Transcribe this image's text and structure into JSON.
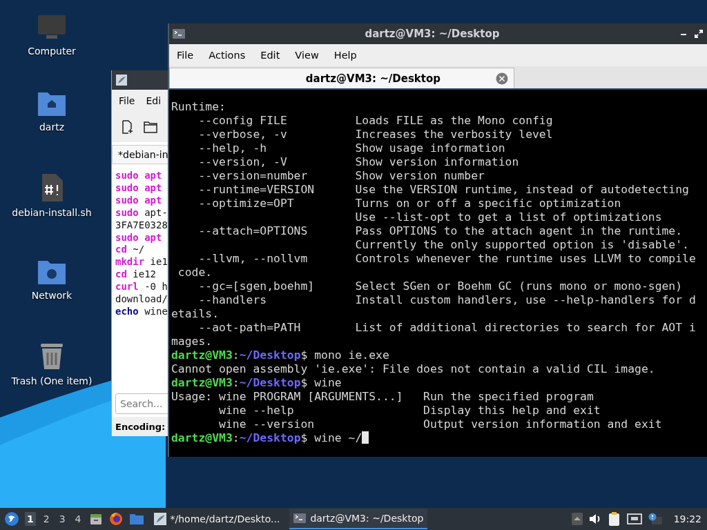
{
  "desktop_icons": [
    {
      "kind": "computer",
      "label": "Computer"
    },
    {
      "kind": "home",
      "label": "dartz"
    },
    {
      "kind": "script",
      "label": "debian-install.sh"
    },
    {
      "kind": "network",
      "label": "Network"
    },
    {
      "kind": "trash",
      "label": "Trash (One item)"
    }
  ],
  "editor": {
    "menu": [
      "File",
      "Edi"
    ],
    "tab": "*debian-in",
    "lines": [
      [
        {
          "kind": "keyword",
          "text": "sudo apt"
        }
      ],
      [
        {
          "kind": "keyword",
          "text": "sudo apt"
        }
      ],
      [
        {
          "kind": "keyword",
          "text": "sudo apt"
        }
      ],
      [
        {
          "kind": "keyword",
          "text": "sudo"
        },
        {
          "kind": "plain",
          "text": " apt-"
        }
      ],
      [
        {
          "kind": "plain",
          "text": "3FA7E0328"
        }
      ],
      [
        {
          "kind": "keyword",
          "text": "sudo apt"
        }
      ],
      [
        {
          "kind": "keyword",
          "text": "cd"
        },
        {
          "kind": "plain",
          "text": " ~/"
        }
      ],
      [
        {
          "kind": "keyword",
          "text": "mkdir"
        },
        {
          "kind": "plain",
          "text": " ie1"
        }
      ],
      [
        {
          "kind": "keyword",
          "text": "cd"
        },
        {
          "kind": "plain",
          "text": " ie12"
        }
      ],
      [
        {
          "kind": "keyword",
          "text": "curl"
        },
        {
          "kind": "plain",
          "text": " -0 h"
        }
      ],
      [
        {
          "kind": "plain",
          "text": "download/"
        }
      ],
      [
        {
          "kind": "builtin",
          "text": "echo"
        },
        {
          "kind": "plain",
          "text": " wine"
        }
      ]
    ],
    "search": {
      "placeholder": "Search..."
    },
    "status": "Encoding:"
  },
  "terminal": {
    "title": "dartz@VM3: ~/Desktop",
    "menu": [
      "File",
      "Actions",
      "Edit",
      "View",
      "Help"
    ],
    "tab": "dartz@VM3: ~/Desktop",
    "lines": [
      [
        {
          "kind": "plain",
          "text": "Runtime:"
        }
      ],
      [
        {
          "kind": "plain",
          "text": "    --config FILE          Loads FILE as the Mono config"
        }
      ],
      [
        {
          "kind": "plain",
          "text": "    --verbose, -v          Increases the verbosity level"
        }
      ],
      [
        {
          "kind": "plain",
          "text": "    --help, -h             Show usage information"
        }
      ],
      [
        {
          "kind": "plain",
          "text": "    --version, -V          Show version information"
        }
      ],
      [
        {
          "kind": "plain",
          "text": "    --version=number       Show version number"
        }
      ],
      [
        {
          "kind": "plain",
          "text": "    --runtime=VERSION      Use the VERSION runtime, instead of autodetecting"
        }
      ],
      [
        {
          "kind": "plain",
          "text": "    --optimize=OPT         Turns on or off a specific optimization"
        }
      ],
      [
        {
          "kind": "plain",
          "text": "                           Use --list-opt to get a list of optimizations"
        }
      ],
      [
        {
          "kind": "plain",
          "text": "    --attach=OPTIONS       Pass OPTIONS to the attach agent in the runtime."
        }
      ],
      [
        {
          "kind": "plain",
          "text": "                           Currently the only supported option is 'disable'."
        }
      ],
      [
        {
          "kind": "plain",
          "text": "    --llvm, --nollvm       Controls whenever the runtime uses LLVM to compile"
        }
      ],
      [
        {
          "kind": "plain",
          "text": " code."
        }
      ],
      [
        {
          "kind": "plain",
          "text": "    --gc=[sgen,boehm]      Select SGen or Boehm GC (runs mono or mono-sgen)"
        }
      ],
      [
        {
          "kind": "plain",
          "text": "    --handlers             Install custom handlers, use --help-handlers for d"
        }
      ],
      [
        {
          "kind": "plain",
          "text": "etails."
        }
      ],
      [
        {
          "kind": "plain",
          "text": "    --aot-path=PATH        List of additional directories to search for AOT i"
        }
      ],
      [
        {
          "kind": "plain",
          "text": "mages."
        }
      ],
      [
        {
          "kind": "user",
          "text": "dartz@VM3"
        },
        {
          "kind": "plain",
          "text": ":"
        },
        {
          "kind": "path",
          "text": "~/Desktop"
        },
        {
          "kind": "plain",
          "text": "$ mono ie.exe"
        }
      ],
      [
        {
          "kind": "plain",
          "text": "Cannot open assembly 'ie.exe': File does not contain a valid CIL image."
        }
      ],
      [
        {
          "kind": "user",
          "text": "dartz@VM3"
        },
        {
          "kind": "plain",
          "text": ":"
        },
        {
          "kind": "path",
          "text": "~/Desktop"
        },
        {
          "kind": "plain",
          "text": "$ wine"
        }
      ],
      [
        {
          "kind": "plain",
          "text": "Usage: wine PROGRAM [ARGUMENTS...]   Run the specified program"
        }
      ],
      [
        {
          "kind": "plain",
          "text": "       wine --help                   Display this help and exit"
        }
      ],
      [
        {
          "kind": "plain",
          "text": "       wine --version                Output version information and exit"
        }
      ],
      [
        {
          "kind": "user",
          "text": "dartz@VM3"
        },
        {
          "kind": "plain",
          "text": ":"
        },
        {
          "kind": "path",
          "text": "~/Desktop"
        },
        {
          "kind": "plain",
          "text": "$ wine ~/"
        },
        {
          "kind": "cursor"
        }
      ]
    ]
  },
  "taskbar": {
    "workspaces": [
      {
        "label": "1",
        "selected": true
      },
      {
        "label": "2",
        "selected": false
      },
      {
        "label": "3",
        "selected": false
      },
      {
        "label": "4",
        "selected": false
      }
    ],
    "tasks": [
      {
        "kind": "editor",
        "label": "*/home/dartz/Deskto...",
        "selected": false
      },
      {
        "kind": "terminal",
        "label": "dartz@VM3: ~/Desktop",
        "selected": true
      }
    ],
    "clock": "19:22"
  }
}
